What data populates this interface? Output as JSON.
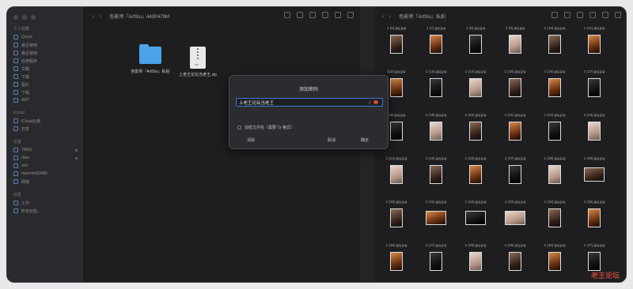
{
  "sidebar": {
    "sections": [
      {
        "title": "个人收藏",
        "items": [
          "Qsync",
          "最近使用",
          "最近使用",
          "应用程序",
          "文稿",
          "下载",
          "图片",
          "下载",
          "ART"
        ]
      },
      {
        "title": "iCloud",
        "items": [
          "iCloud云盘",
          "共享"
        ]
      },
      {
        "title": "位置",
        "items": [
          "YANG",
          "data",
          "skd",
          "macmini(SMB)",
          "网络"
        ]
      },
      {
        "title": "标签",
        "items": [
          "工作",
          "所有标签..."
        ]
      }
    ]
  },
  "pane1": {
    "title": "色影师『ArtStu』440P479M",
    "files": [
      {
        "name": "色影师『ArtStu』私拍",
        "kind": "folder"
      },
      {
        "name": "上老王论坛当老王.zip",
        "kind": "zip",
        "tag": "ZIP"
      }
    ]
  },
  "pane2": {
    "title": "色影师『ArtStu』私拍",
    "rows": [
      [
        "1 (6).jpg.jpg",
        "1 (7).jpg.jpg",
        "1 (8).jpg.jpg",
        "1 (9).jpg.jpg",
        "1 (10).jpg.jpg",
        "1 (11).jpg.jpg"
      ],
      [
        "(12).jpg.jpg",
        "1 (13).jpg.jpg",
        "1 (14).jpg.jpg",
        "1 (15).jpg.jpg",
        "1 (16).jpg.jpg",
        "1 (17).jpg.jpg"
      ],
      [
        "(18).jpg.jpg",
        "1 (19).jpg.jpg",
        "1 (20).jpg.jpg",
        "1 (21).jpg.jpg",
        "1 (22).jpg.jpg",
        "1 (23).jpg.jpg"
      ],
      [
        "1 (24).jpg.jpg",
        "1 (25).jpg.jpg",
        "1 (26).jpg.jpg",
        "1 (27).jpg.jpg",
        "1 (28).jpg.jpg",
        "1 (29).jpg.jpg"
      ],
      [
        "1 (30).jpg.jpg",
        "1 (31).jpg.jpg",
        "1 (32).jpg.jpg",
        "1 (33).jpg.jpg",
        "1 (34).jpg.jpg",
        "1 (35).jpg.jpg"
      ],
      [
        "1 (36).jpg.jpg",
        "1 (37).jpg.jpg",
        "1 (38).jpg.jpg",
        "1 (39).jpg.jpg",
        "1 (40).jpg.jpg",
        "1 (47).jpg.jpg"
      ]
    ]
  },
  "dialog": {
    "title": "添加密码",
    "password_value": "上老王论坛当老王",
    "checkbox_label": "加密文件名（需要 7z 格式）",
    "clear_label": "清除",
    "cancel_label": "取消",
    "ok_label": "确定"
  },
  "watermark": "老王论坛"
}
